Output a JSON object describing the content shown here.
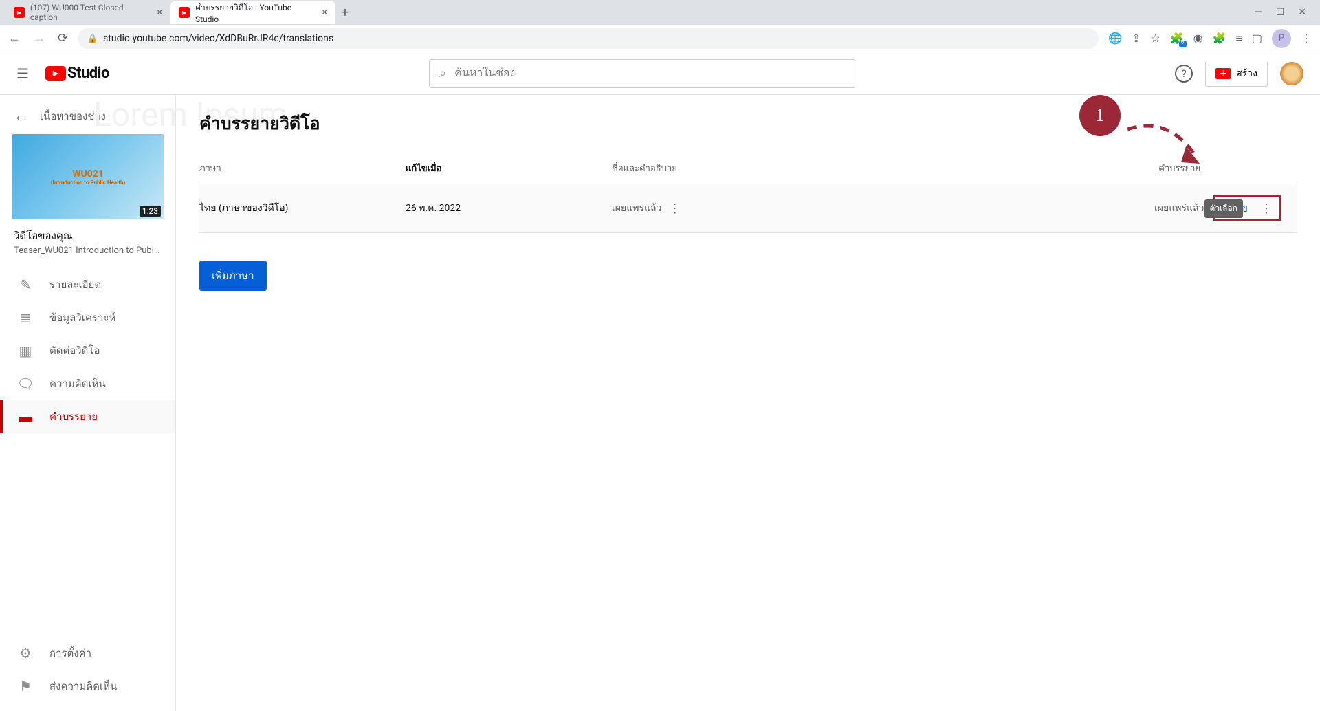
{
  "browser": {
    "tabs": [
      {
        "title": "(107) WU000 Test Closed caption"
      },
      {
        "title": "คำบรรยายวิดีโอ - YouTube Studio"
      }
    ],
    "url": "studio.youtube.com/video/XdDBuRrJR4c/translations",
    "avatar_letter": "P"
  },
  "header": {
    "studio_label": "Studio",
    "search_placeholder": "ค้นหาในช่อง",
    "create_label": "สร้าง"
  },
  "sidebar": {
    "channel_content_label": "เนื้อหาของช่อง",
    "thumb_duration": "1:23",
    "thumb_text1": "WU021",
    "thumb_text2": "(Introduction to Public Health)",
    "video_heading": "วิดีโอของคุณ",
    "video_title": "Teaser_WU021 Introduction to Publi...",
    "nav": [
      {
        "icon": "✎",
        "label": "รายละเอียด"
      },
      {
        "icon": "≣",
        "label": "ข้อมูลวิเคราะห์"
      },
      {
        "icon": "▦",
        "label": "ตัดต่อวิดีโอ"
      },
      {
        "icon": "🗨",
        "label": "ความคิดเห็น"
      },
      {
        "icon": "▬",
        "label": "คำบรรยาย"
      }
    ],
    "bottom": [
      {
        "icon": "⚙",
        "label": "การตั้งค่า"
      },
      {
        "icon": "⚑",
        "label": "ส่งความคิดเห็น"
      }
    ]
  },
  "main": {
    "watermark": "Lorem Ipsum",
    "page_title": "คำบรรยายวิดีโอ",
    "columns": {
      "language": "ภาษา",
      "modified": "แก้ไขเมื่อ",
      "title_desc": "ชื่อและคำอธิบาย",
      "subtitles": "คำบรรยาย"
    },
    "row": {
      "language": "ไทย (ภาษาของวิดีโอ)",
      "modified": "26 พ.ค. 2022",
      "title_status": "เผยแพร่แล้ว",
      "sub_status": "เผยแพร่แล้ว",
      "edit_label": "แก้ไข"
    },
    "add_language_label": "เพิ่มภาษา",
    "tooltip": "ตัวเลือก",
    "annotation_number": "1"
  }
}
